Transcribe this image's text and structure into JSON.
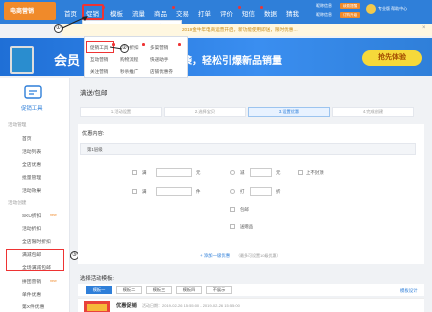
{
  "brand": {
    "logo_text": "电商营销",
    "accent": "#2f7fd9"
  },
  "nav": {
    "items": [
      "首页",
      "促销",
      "模板",
      "流量",
      "商品",
      "交易",
      "打单",
      "评价",
      "短信",
      "数据",
      "猜我"
    ]
  },
  "top_right": {
    "line1": "昵称信息",
    "line2": "昵称信息",
    "btn1": "续费提醒",
    "btn2": "订购升级",
    "user": "专业版 帮助中心"
  },
  "dropdown_top": {
    "left": "折扣",
    "mid": "满减/包邮",
    "right": "优惠券"
  },
  "notice": {
    "text": "2019金牛年电商运营开启，新功能使用即送，限时优惠…"
  },
  "menu": {
    "col1": [
      "促销工具",
      "互动营销",
      "关注营销"
    ],
    "col2": [
      "SKU折扣",
      "购物流程",
      "秒杀推广"
    ],
    "col3": [
      "多渠营销",
      "快递助手",
      "店铺优惠券"
    ]
  },
  "banner": {
    "title": "会员",
    "subtitle": "找新会员营销来袭，轻松引爆新品销量",
    "button": "抢先体验"
  },
  "callouts": {
    "one": "①",
    "two": "②",
    "three": "③"
  },
  "sidebar": {
    "title": "促销工具",
    "section1": "活动管理",
    "items1": [
      "首页",
      "活动列表",
      "全店优惠",
      "批量管理",
      "活动效果"
    ],
    "section2": "活动创建",
    "items2": [
      "SKU折扣",
      "活动折扣",
      "全店限时折扣",
      "满减包邮",
      "全场满减包邮",
      "拼团营销",
      "单件优惠",
      "第X件优惠"
    ],
    "new_tag": "new"
  },
  "main": {
    "breadcrumb": "满送/包邮",
    "steps": [
      "1.活动设置",
      "2.选择宝贝",
      "3.设置优惠",
      "4.完成创建"
    ],
    "content_label": "优惠内容:",
    "tier_label": "第1层级",
    "row1": {
      "a": "满",
      "a_unit": "元",
      "b": "减",
      "b_unit": "元",
      "c": "上不封顶"
    },
    "row2": {
      "a": "满",
      "a_unit": "件",
      "b": "打",
      "b_unit": "折"
    },
    "row3": {
      "b": "包邮"
    },
    "row4": {
      "b": "送赠品"
    },
    "add_tier": "+ 添加一级优惠",
    "add_note": "（最多可设置10级优惠）",
    "template_label": "选择活动模板:",
    "template_tabs": [
      "模板一",
      "模板二",
      "模板三",
      "模板四",
      "不展示"
    ],
    "template_link": "模板设计",
    "promo_text": "优惠促销",
    "promo_meta": "活动日期：2019-02-26 15:55:00 - 2019-02-26 15:55:00"
  }
}
